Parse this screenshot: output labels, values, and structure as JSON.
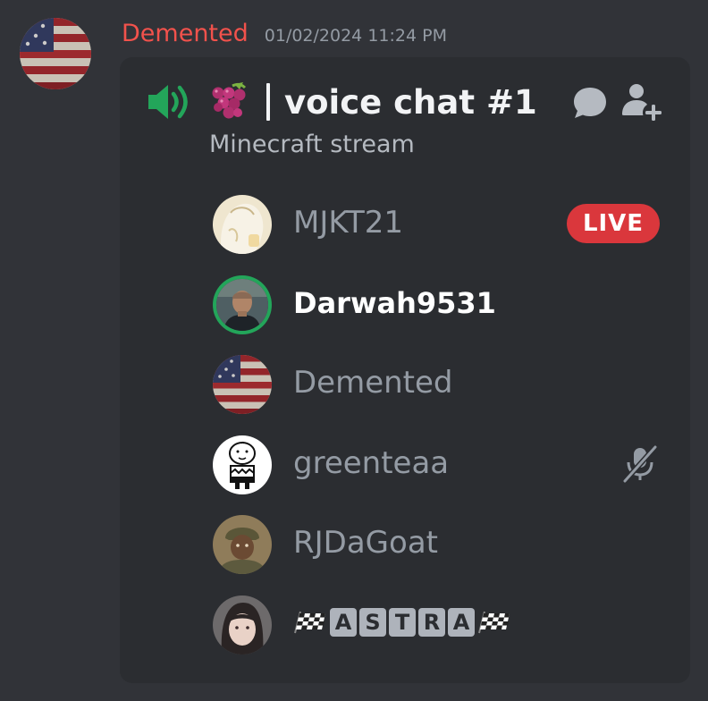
{
  "message": {
    "author": "Demented",
    "timestamp": "01/02/2024 11:24 PM",
    "author_color": "#f2524c"
  },
  "voice_channel": {
    "emoji": "grapes-icon",
    "name": "voice chat #1",
    "topic": "Minecraft stream",
    "speaker_color": "#23a55a",
    "icons": [
      "speaker-icon",
      "chat-bubble-icon",
      "add-user-icon"
    ]
  },
  "members": [
    {
      "name": "MJKT21",
      "avatar": "avatar-mjkt21",
      "badge": "LIVE",
      "speaking": false
    },
    {
      "name": "Darwah9531",
      "avatar": "avatar-darwah9531",
      "speaking": true
    },
    {
      "name": "Demented",
      "avatar": "avatar-demented",
      "speaking": false
    },
    {
      "name": "greenteaa",
      "avatar": "avatar-greenteaa",
      "status_icon": "mic-muted-icon",
      "speaking": false
    },
    {
      "name": "RJDaGoat",
      "avatar": "avatar-rjdagoat",
      "speaking": false
    },
    {
      "name": "🏁ASTRA🏁",
      "letters": [
        "A",
        "S",
        "T",
        "R",
        "A"
      ],
      "avatar": "avatar-astra",
      "speaking": false
    }
  ],
  "colors": {
    "background": "#313338",
    "embed": "#2b2d31",
    "live": "#da373c",
    "speaking_ring": "#23a55a"
  }
}
